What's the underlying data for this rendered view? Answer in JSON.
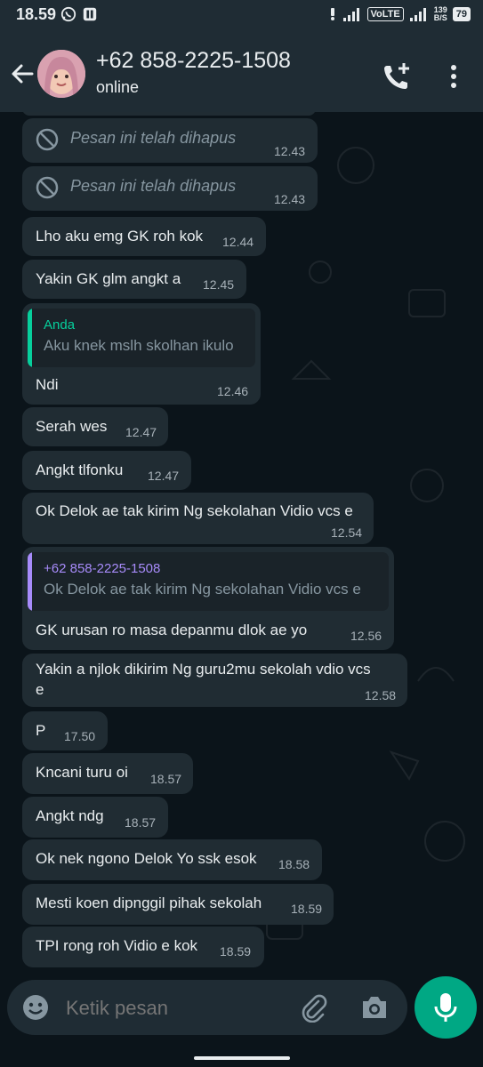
{
  "status_bar": {
    "time": "18.59",
    "volte": "VoLTE",
    "net_speed_value": "139",
    "net_speed_unit": "B/S",
    "battery": "79"
  },
  "header": {
    "contact_name": "+62 858-2225-1508",
    "status": "online"
  },
  "messages": [
    {
      "type": "deleted",
      "text": "Pesan ini telah dihapus",
      "time": "12.43"
    },
    {
      "type": "deleted",
      "text": "Pesan ini telah dihapus",
      "time": "12.43"
    },
    {
      "type": "text",
      "text": "Lho aku emg GK roh kok",
      "time": "12.44"
    },
    {
      "type": "text",
      "text": "Yakin GK glm angkt a",
      "time": "12.45"
    },
    {
      "type": "reply",
      "quote_author": "Anda",
      "quote_text": "Aku knek mslh skolhan ikulo",
      "text": "Ndi",
      "time": "12.46"
    },
    {
      "type": "text",
      "text": "Serah wes",
      "time": "12.47"
    },
    {
      "type": "text",
      "text": "Angkt tlfonku",
      "time": "12.47"
    },
    {
      "type": "text",
      "text": "Ok Delok ae tak kirim Ng sekolahan Vidio vcs e",
      "time": "12.54"
    },
    {
      "type": "reply",
      "quote_author": "+62 858-2225-1508",
      "quote_text": "Ok Delok ae tak kirim Ng sekolahan Vidio vcs e",
      "text": "GK urusan ro masa depanmu dlok ae yo",
      "time": "12.56"
    },
    {
      "type": "text",
      "text": "Yakin a njlok dikirim Ng guru2mu sekolah vdio vcs",
      "text2": "e",
      "time": "12.58"
    },
    {
      "type": "text",
      "text": "P",
      "time": "17.50"
    },
    {
      "type": "text",
      "text": "Kncani turu oi",
      "time": "18.57"
    },
    {
      "type": "text",
      "text": "Angkt ndg",
      "time": "18.57"
    },
    {
      "type": "text",
      "text": "Ok nek ngono Delok Yo ssk esok",
      "time": "18.58"
    },
    {
      "type": "text",
      "text": "Mesti koen dipnggil pihak sekolah",
      "time": "18.59"
    },
    {
      "type": "text",
      "text": "TPI rong roh Vidio e kok",
      "time": "18.59"
    }
  ],
  "input": {
    "placeholder": "Ketik pesan"
  },
  "colors": {
    "quote_bar_self": "#06cf9c",
    "quote_bar_contact": "#a78bfa",
    "accent": "#00a884"
  }
}
